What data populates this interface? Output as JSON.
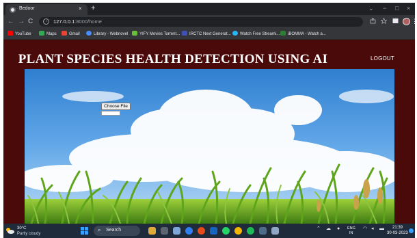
{
  "browser": {
    "tab_title": "Bedoor",
    "tab_close": "×",
    "new_tab": "+",
    "window_controls": {
      "minimize": "⌄",
      "restore": "−",
      "maximize": "□",
      "close": "×"
    },
    "nav": {
      "back": "←",
      "forward": "→",
      "reload": "C"
    },
    "url_host": "127.0.0.1",
    "url_path": ":8000/home",
    "toolbar_icons": [
      "share-icon",
      "star-icon",
      "sidebar-icon",
      "profile-icon",
      "menu-icon"
    ],
    "bookmarks": [
      {
        "label": "YouTube",
        "icon_color": "#ff0000"
      },
      {
        "label": "Maps",
        "icon_color": "#34a853"
      },
      {
        "label": "Gmail",
        "icon_color": "#ea4335"
      },
      {
        "label": "Library - Webnovel",
        "icon_color": "#4a8cff"
      },
      {
        "label": "YIFY Movies Torrent...",
        "icon_color": "#6bbf3a"
      },
      {
        "label": "IRCTC Next Generat...",
        "icon_color": "#3f51b5"
      },
      {
        "label": "Watch Free Streami...",
        "icon_color": "#29b6f6"
      },
      {
        "label": "iBOMMA - Watch a...",
        "icon_color": "#2e7d32"
      }
    ]
  },
  "page": {
    "title": "PLANT SPECIES HEALTH DETECTION USING AI",
    "logout_label": "LOGOUT",
    "choose_file_label": "Choose File",
    "background_color": "#4a0a0a",
    "title_color": "#ffffff"
  },
  "taskbar": {
    "temperature": "30°C",
    "weather": "Partly cloudy",
    "search_label": "Search",
    "language": "ENG",
    "region": "IN",
    "time": "21:39",
    "date": "30-03-2023",
    "tray_icons": [
      "chevron-up-icon",
      "cloud-icon",
      "wifi-icon",
      "volume-icon",
      "battery-icon"
    ]
  }
}
